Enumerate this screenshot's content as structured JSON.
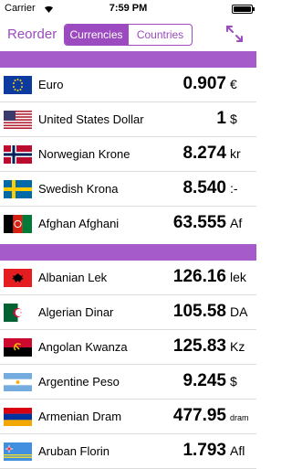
{
  "status_bar": {
    "carrier": "Carrier",
    "time": "7:59 PM"
  },
  "nav": {
    "reorder": "Reorder",
    "segments": [
      "Currencies",
      "Countries"
    ],
    "selected_segment": "Currencies",
    "accent_color": "#9b4bbf"
  },
  "favorites": [
    {
      "name": "Euro",
      "value": "0.907",
      "symbol": "€",
      "flag": "eu-flag-icon"
    },
    {
      "name": "United States Dollar",
      "value": "1",
      "symbol": "$",
      "flag": "us-flag-icon"
    },
    {
      "name": "Norwegian Krone",
      "value": "8.274",
      "symbol": "kr",
      "flag": "norway-flag-icon"
    },
    {
      "name": "Swedish Krona",
      "value": "8.540",
      "symbol": ":-",
      "flag": "sweden-flag-icon"
    },
    {
      "name": "Afghan Afghani",
      "value": "63.555",
      "symbol": "Af",
      "flag": "afghanistan-flag-icon"
    }
  ],
  "currencies": [
    {
      "name": "Albanian Lek",
      "value": "126.16",
      "symbol": "lek",
      "flag": "albania-flag-icon"
    },
    {
      "name": "Algerian Dinar",
      "value": "105.58",
      "symbol": "DA",
      "flag": "algeria-flag-icon"
    },
    {
      "name": "Angolan Kwanza",
      "value": "125.83",
      "symbol": "Kz",
      "flag": "angola-flag-icon"
    },
    {
      "name": "Argentine Peso",
      "value": "9.245",
      "symbol": "$",
      "flag": "argentina-flag-icon"
    },
    {
      "name": "Armenian Dram",
      "value": "477.95",
      "symbol": "dram",
      "flag": "armenia-flag-icon"
    },
    {
      "name": "Aruban Florin",
      "value": "1.793",
      "symbol": "Afl",
      "flag": "aruba-flag-icon"
    }
  ]
}
